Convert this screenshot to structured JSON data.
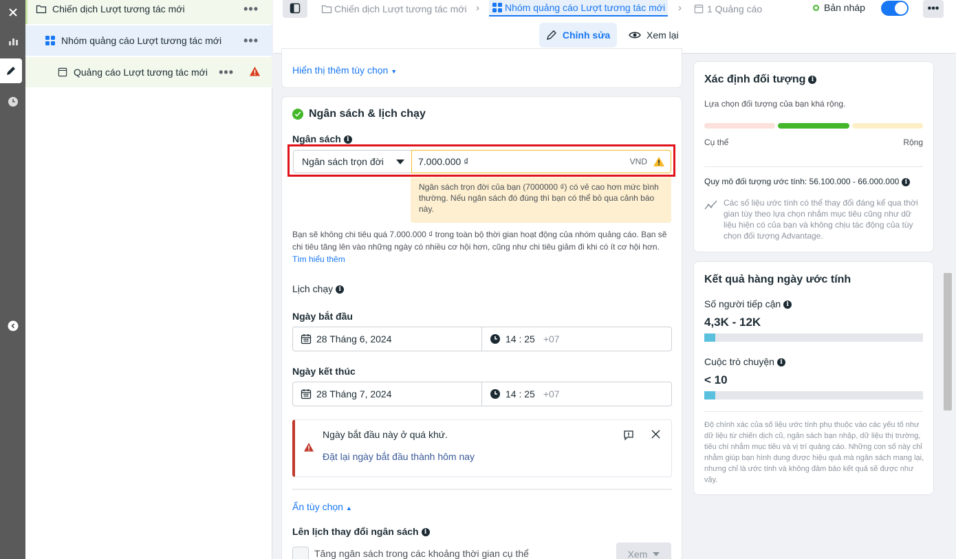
{
  "tree": {
    "campaign": "Chiến dịch Lượt tương tác mới",
    "adset": "Nhóm quảng cáo Lượt tương tác mới",
    "ad": "Quảng cáo Lượt tương tác mới",
    "more": "•••"
  },
  "topbar": {
    "crumb_campaign": "Chiến dịch Lượt tương tác mới",
    "crumb_adset": "Nhóm quảng cáo Lượt tương tác mới",
    "crumb_ad": "1 Quảng cáo",
    "status": "Bản nháp",
    "more": "•••",
    "edit_label": "Chỉnh sửa",
    "review_label": "Xem lại"
  },
  "main": {
    "show_more_options": "Hiển thị thêm tùy chọn",
    "section_title": "Ngân sách & lịch chạy",
    "budget_label": "Ngân sách",
    "budget_type": "Ngân sách trọn đời",
    "budget_value": "7.000.000 ₫",
    "currency": "VND",
    "budget_warning": "Ngân sách trọn đời của bạn (7000000 ₫) có vẻ cao hơn mức bình thường. Nếu ngân sách đó đúng thì bạn có thể bỏ qua cảnh báo này.",
    "budget_desc": "Bạn sẽ không chi tiêu quá 7.000.000 ₫ trong toàn bộ thời gian hoạt động của nhóm quảng cáo. Bạn sẽ chi tiêu tăng lên vào những ngày có nhiều cơ hội hơn, cũng như chi tiêu giảm đi khi có ít cơ hội hơn.",
    "learn_more": "Tìm hiểu thêm",
    "schedule_label": "Lịch chạy",
    "start_label": "Ngày bắt đầu",
    "start_date": "28 Tháng 6, 2024",
    "start_time": "14 : 25",
    "end_label": "Ngày kết thúc",
    "end_date": "28 Tháng 7, 2024",
    "end_time": "14 : 25",
    "timezone": "+07",
    "alert_msg": "Ngày bắt đầu này ở quá khứ.",
    "alert_action": "Đặt lại ngày bắt đầu thành hôm nay",
    "hide_options": "Ẩn tùy chọn",
    "budget_schedule_label": "Lên lịch thay đổi ngân sách",
    "increase_budget": "Tăng ngân sách trong các khoảng thời gian cụ thể",
    "see_btn": "Xem"
  },
  "audience": {
    "title": "Xác định đối tượng",
    "desc": "Lựa chọn đối tượng của bạn khá rộng.",
    "specific": "Cụ thể",
    "broad": "Rộng",
    "size": "Quy mô đối tượng ước tính: 56.100.000 - 66.000.000",
    "note": "Các số liệu ước tính có thể thay đổi đáng kể qua thời gian tùy theo lựa chọn nhắm mục tiêu cũng như dữ liệu hiện có của bạn và không chịu tác động của tùy chọn đối tượng Advantage.",
    "level": "broad"
  },
  "results": {
    "title": "Kết quả hàng ngày ước tính",
    "reach_label": "Số người tiếp cận",
    "reach_value": "4,3K - 12K",
    "conv_label": "Cuộc trò chuyện",
    "conv_value": "< 10",
    "footnote": "Độ chính xác của số liệu ước tính phụ thuộc vào các yếu tố như dữ liệu từ chiến dịch cũ, ngân sách bạn nhập, dữ liệu thị trường, tiêu chí nhắm mục tiêu và vị trí quảng cáo. Những con số này chỉ nhằm giúp bạn hình dung được hiệu quả mà ngân sách mang lại, nhưng chỉ là ước tính và không đảm bảo kết quả sẽ được như vậy."
  },
  "colors": {
    "accent": "#1877f2",
    "alert": "#e0131b",
    "success": "#42b72a",
    "warning": "#f7b928"
  }
}
